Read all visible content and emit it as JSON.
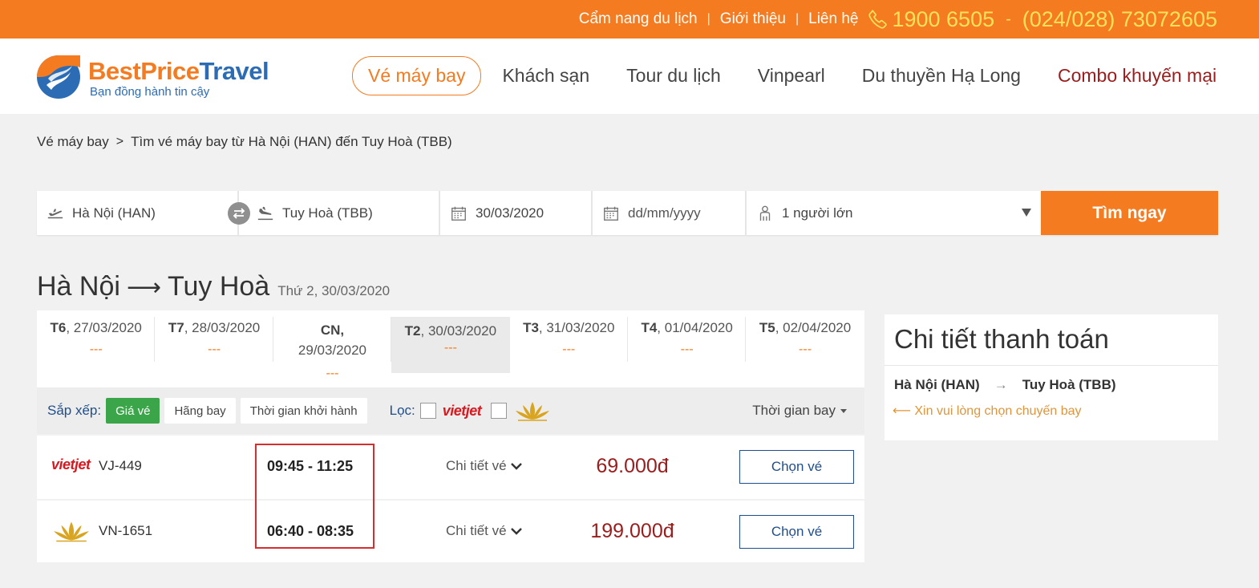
{
  "topbar": {
    "links": [
      "Cẩm nang du lịch",
      "Giới thiệu",
      "Liên hệ"
    ],
    "separator": "|",
    "phone1": "1900 6505",
    "dash": "-",
    "phone2": "(024/028) 73072605"
  },
  "logo": {
    "brand_part1": "BestPrice",
    "brand_part2": "Travel",
    "slogan": "Bạn đồng hành tin cậy"
  },
  "nav": [
    "Vé máy bay",
    "Khách sạn",
    "Tour du lịch",
    "Vinpearl",
    "Du thuyền Hạ Long",
    "Combo khuyến mại"
  ],
  "breadcrumb": {
    "root": "Vé máy bay",
    "chevron": ">",
    "current": "Tìm vé máy bay từ Hà Nội (HAN) đến Tuy Hoà (TBB)"
  },
  "search": {
    "from": "Hà Nội (HAN)",
    "to": "Tuy Hoà (TBB)",
    "depart_date": "30/03/2020",
    "return_placeholder": "dd/mm/yyyy",
    "passengers": "1 người lớn",
    "button": "Tìm ngay"
  },
  "route": {
    "from": "Hà Nội",
    "arrow": "⟶",
    "to": "Tuy Hoà",
    "date": "Thứ 2, 30/03/2020"
  },
  "date_tabs": [
    {
      "day": "T6",
      "date": ", 27/03/2020",
      "price": "---"
    },
    {
      "day": "T7",
      "date": ", 28/03/2020",
      "price": "---"
    },
    {
      "day": "CN",
      "date": "29/03/2020",
      "price": "---"
    },
    {
      "day": "T2",
      "date": ", 30/03/2020",
      "price": "---"
    },
    {
      "day": "T3",
      "date": ", 31/03/2020",
      "price": "---"
    },
    {
      "day": "T4",
      "date": ", 01/04/2020",
      "price": "---"
    },
    {
      "day": "T5",
      "date": ", 02/04/2020",
      "price": "---"
    }
  ],
  "sortbar": {
    "sort_label": "Sắp xếp:",
    "sort_options": [
      "Giá vé",
      "Hãng bay",
      "Thời gian khởi hành"
    ],
    "filter_label": "Lọc:",
    "vietjet_logo": "vietjet",
    "flight_time": "Thời gian bay"
  },
  "flights": [
    {
      "airline_logo": "vietjet",
      "code": "VJ-449",
      "time": "09:45 - 11:25",
      "detail": "Chi tiết vé",
      "price": "69.000đ",
      "button": "Chọn vé"
    },
    {
      "airline_logo": "lotus-icon",
      "code": "VN-1651",
      "time": "06:40 - 08:35",
      "detail": "Chi tiết vé",
      "price": "199.000đ",
      "button": "Chọn vé"
    }
  ],
  "payment": {
    "title": "Chi tiết thanh toán",
    "from": "Hà Nội (HAN)",
    "arrow": "→",
    "to": "Tuy Hoà (TBB)",
    "hint": "⟵ Xin vui lòng chọn chuyến bay"
  },
  "colors": {
    "brand_orange": "#f47b20",
    "brand_blue": "#2b6cb5",
    "price_red": "#9b1c1c",
    "sort_green": "#3ba54a",
    "highlight_red": "#d32f2f"
  }
}
